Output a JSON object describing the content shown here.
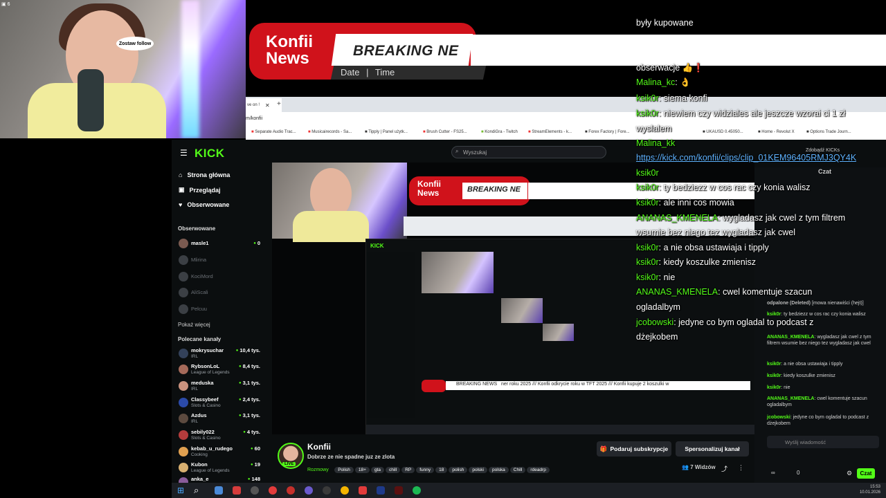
{
  "webcam": {
    "badge": "6",
    "bubble_text": "Zostaw follow"
  },
  "overlay": {
    "konfii_line1": "Konfii",
    "konfii_line2": "News",
    "breaking": "BREAKING NE",
    "date": "Date",
    "sep": "|",
    "time": "Time"
  },
  "browser": {
    "tab_text": "ve on !",
    "url": "m/konfii",
    "bookmarks": [
      "Separate Audio Trac...",
      "Musicairecords - Sa...",
      "Tipply | Panel użytk...",
      "Brush Cutter - FS25...",
      "KondiGra - Twitch",
      "StreamElements - k...",
      "Forex Factory | Fore..."
    ],
    "bookmarks_right": [
      "UKAUSD 0.45050...",
      "Home - Revolut X",
      "Options Trade Journ..."
    ]
  },
  "kick": {
    "logo": "KICK",
    "search_placeholder": "Wyszukaj",
    "nav": [
      {
        "label": "Strona główna",
        "icon": "home-icon"
      },
      {
        "label": "Przeglądaj",
        "icon": "browse-icon"
      },
      {
        "label": "Obserwowane",
        "icon": "heart-icon"
      }
    ],
    "followed_title": "Obserwowane",
    "followed": [
      {
        "name": "masle1",
        "viewers": "0",
        "online": true
      },
      {
        "name": "Mlirina",
        "viewers": "",
        "online": false
      },
      {
        "name": "KociMord",
        "viewers": "",
        "online": false
      },
      {
        "name": "AliScali",
        "viewers": "",
        "online": false
      },
      {
        "name": "Pelcuu",
        "viewers": "",
        "online": false
      }
    ],
    "show_more": "Pokaż więcej",
    "recommended_title": "Polecane kanały",
    "recommended": [
      {
        "name": "mokrysuchar",
        "category": "IRL",
        "viewers": "10,4 tys."
      },
      {
        "name": "RybsonLoL",
        "category": "League of Legends",
        "viewers": "8,4 tys."
      },
      {
        "name": "meduska",
        "category": "IRL",
        "viewers": "3,1 tys."
      },
      {
        "name": "Classybeef",
        "category": "Slots & Casino",
        "viewers": "2,4 tys."
      },
      {
        "name": "Azdus",
        "category": "IRL",
        "viewers": "3,1 tys."
      },
      {
        "name": "sebily022",
        "category": "Slots & Casino",
        "viewers": "4 tys."
      },
      {
        "name": "kebab_u_rudego",
        "category": "Cooking",
        "viewers": "60"
      },
      {
        "name": "Kubon",
        "category": "League of Legends",
        "viewers": "19"
      },
      {
        "name": "anka_e",
        "category": "",
        "viewers": "148"
      }
    ],
    "channel": {
      "name": "Konfii",
      "title": "Dobrze ze nie spadne juz ze zlota",
      "category": "Rozmowy",
      "tags": [
        "Polish",
        "18+",
        "gta",
        "chill",
        "RP",
        "funny",
        "18",
        "polish",
        "polski",
        "polska",
        "Chill",
        "rdeadrp"
      ],
      "subscribe_btn": "Podaruj subskrypcje",
      "customize_btn": "Spersonalizuj kanał",
      "viewers": "7 Widzów",
      "live_badge": "LIVE"
    },
    "get_kicks": "Zdobądź KICKs",
    "chat_title": "Czat",
    "chat_input_placeholder": "Wyślij wiadomość",
    "chat_btn": "Czat",
    "chat_footer": [
      "∞",
      "0"
    ]
  },
  "chat_overlay": [
    {
      "user": "",
      "text": "były kupowane"
    },
    {
      "user": "",
      "text": "obserwacje 👍❗"
    },
    {
      "user": "Malina_kc",
      "text": "👌"
    },
    {
      "user": "ksik0r",
      "text": "siema konfi"
    },
    {
      "user": "ksik0r",
      "text": "niewiem czy widziales ale jeszcze wzorai ci 1 zł"
    },
    {
      "user": "",
      "text": "wyslalem"
    },
    {
      "user": "Malina_kk",
      "text": ""
    },
    {
      "user": "",
      "text": "https://kick.com/konfii/clips/clip_01KEM96405RMJ3QY4K"
    },
    {
      "user": "ksik0r",
      "text": ""
    },
    {
      "user": "ksik0r",
      "text": "ty bedziezz w cos rac czy konia walisz"
    },
    {
      "user": "ksik0r",
      "text": "ale inni cos mowia"
    },
    {
      "user": "ANANAS_KMENELA",
      "text": "wygladasz jak cwel z tym filtrem"
    },
    {
      "user": "",
      "text": "wsumie bez niego tez wygladasz jak cwel"
    },
    {
      "user": "ksik0r",
      "text": "a nie obsa ustawiaja i tipply"
    },
    {
      "user": "ksik0r",
      "text": "kiedy koszulke zmienisz"
    },
    {
      "user": "ksik0r",
      "text": "nie"
    },
    {
      "user": "ANANAS_KMENELA",
      "text": "cwel komentuje szacun"
    },
    {
      "user": "",
      "text": "ogladalbym"
    },
    {
      "user": "jcobowski",
      "text": "jedyne co bym ogladal to podcast z"
    },
    {
      "user": "",
      "text": "dżejkobem"
    }
  ],
  "small_chat": [
    {
      "user": "odpalone (Deleted)",
      "text": "[mowa nienawiści (hejt)]"
    },
    {
      "user": "ksik0r",
      "text": "ty bedziezz w cos rac czy konia walisz"
    },
    {
      "user": "ANANAS_KMENELA",
      "text": "wygladasz jak cwel z tym filtrem wsumie bez niego tez wygladasz jak cwel"
    },
    {
      "user": "ksik0r",
      "text": "a nie obsa ustawiaja i tipply"
    },
    {
      "user": "ksik0r",
      "text": "kiedy koszulke zmienisz"
    },
    {
      "user": "ksik0r",
      "text": "nie"
    },
    {
      "user": "ANANAS_KMENELA",
      "text": "cwel komentuje szacun ogladalbym"
    },
    {
      "user": "jcobowski",
      "text": "jedyne co bym ogladal to podcast z dżejkobem"
    }
  ],
  "taskbar": {
    "time": "15:53",
    "date": "10.01.2026"
  },
  "colors": {
    "kick_green": "#53fc18",
    "breaking_red": "#d0121b"
  }
}
